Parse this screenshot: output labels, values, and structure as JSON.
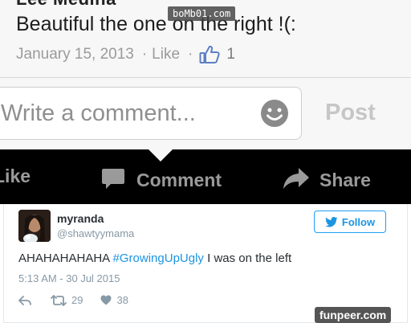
{
  "facebook": {
    "author_name": "Lee Medina",
    "comment_text": "Beautiful the one on the right !(:",
    "date": "January 15, 2013",
    "separator": "·",
    "like_link": "Like",
    "like_count": "1",
    "comment_placeholder": "Write a comment...",
    "post_button": "Post",
    "actions": {
      "like": "Like",
      "comment": "Comment",
      "share": "Share"
    },
    "icons": [
      "thumbs-up-icon",
      "smiley-icon",
      "comment-bubble-icon",
      "share-arrow-icon"
    ]
  },
  "tweet": {
    "display_name": "myranda",
    "handle": "@shawtyymama",
    "follow_label": "Follow",
    "text_before": "AHAHAHAHAHA ",
    "hashtag": "#GrowingUpUgly",
    "text_after": " I was on the left",
    "timestamp": "5:13 AM - 30 Jul 2015",
    "retweets": "29",
    "likes": "38",
    "icons": [
      "twitter-bird-icon",
      "reply-icon",
      "retweet-icon",
      "heart-icon"
    ]
  },
  "watermarks": {
    "top": "boMb01.com",
    "bottom": "funpeer.com"
  },
  "colors": {
    "twitter_blue": "#1b95e0",
    "facebook_bar": "#000000",
    "muted_gray": "#9b9b9b"
  }
}
